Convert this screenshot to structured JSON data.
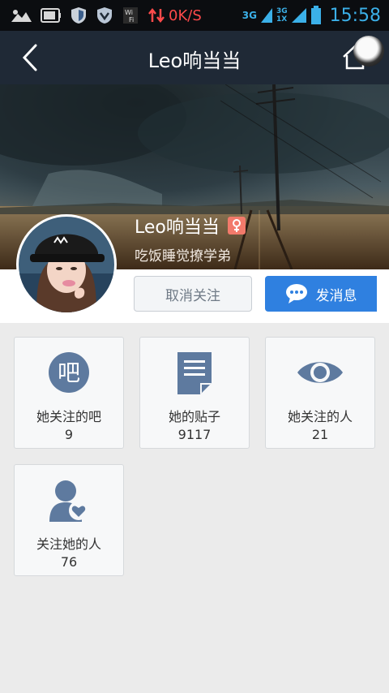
{
  "status_bar": {
    "net_speed": "0K/S",
    "network_left": "3G",
    "network_right": "3G",
    "network_sub": "1X",
    "time": "15:58"
  },
  "header": {
    "title": "Leo响当当"
  },
  "profile": {
    "name": "Leo响当当",
    "signature": "吃饭睡觉撩学弟",
    "gender_icon": "female-icon"
  },
  "actions": {
    "unfollow_label": "取消关注",
    "message_label": "发消息"
  },
  "stats": [
    {
      "icon": "forum-ba-icon",
      "icon_text": "吧",
      "label": "她关注的吧",
      "count": "9"
    },
    {
      "icon": "post-document-icon",
      "label": "她的贴子",
      "count": "9117"
    },
    {
      "icon": "eye-icon",
      "label": "她关注的人",
      "count": "21"
    },
    {
      "icon": "fans-user-heart-icon",
      "label": "关注她的人",
      "count": "76"
    }
  ],
  "colors": {
    "header_bg": "#1f2936",
    "accent_blue": "#2f80e0",
    "icon_slate": "#5e7a9f",
    "status_blue": "#3bb0e8",
    "net_speed_red": "#ff4a4a"
  }
}
